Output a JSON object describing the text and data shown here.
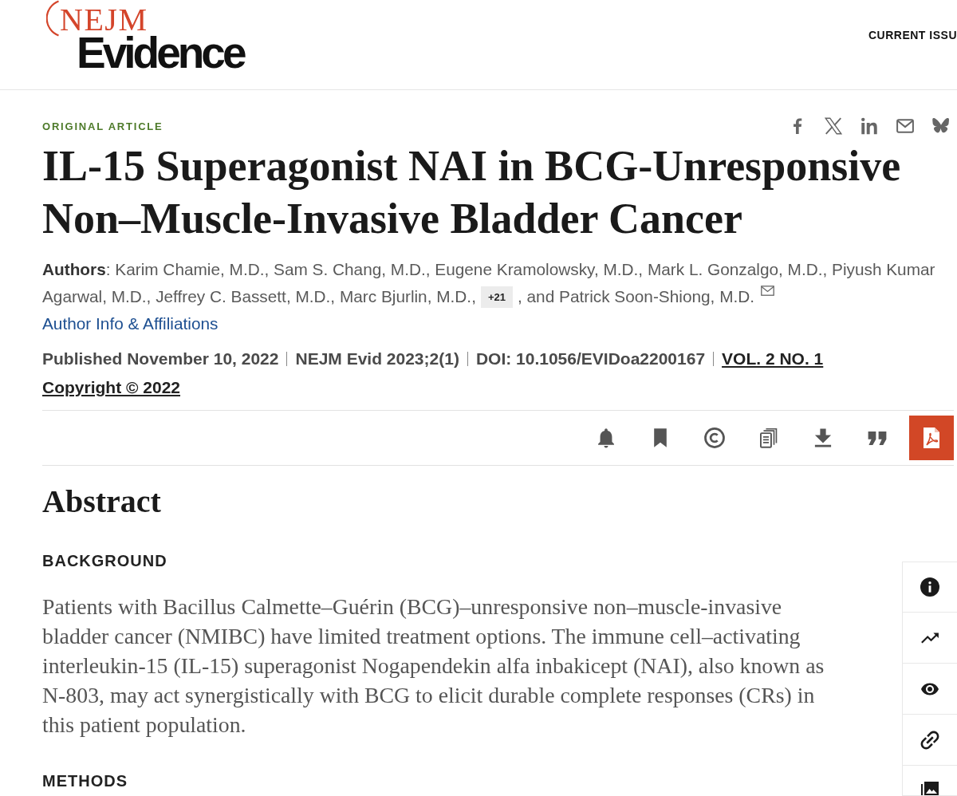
{
  "header": {
    "logo": {
      "wordmark": "NEJM",
      "title": "Evidence"
    },
    "nav": [
      "CURRENT ISSU"
    ]
  },
  "article": {
    "category": "ORIGINAL ARTICLE",
    "title": "IL-15 Superagonist NAI in BCG-Unresponsive Non–Muscle-Invasive Bladder Cancer",
    "authors": {
      "list": "**Authors**: Karim Chamie, M.D., Sam S. Chang, M.D., Eugene Kramolowsky, M.D., Mark L. Gonzalgo, M.D., Piyush Kumar Agarwal, M.D., Jeffrey C. Bassett, M.D., Marc Bjurlin, M.D.,",
      "more_button": "+21",
      "last": ", and Patrick Soon-Shiong, M.D.",
      "info_link": "Author Info & Affiliations"
    },
    "meta": [
      {
        "kind": "text",
        "text": "Published November 10, 2022"
      },
      {
        "kind": "text",
        "text": "NEJM Evid 2023;2(1)"
      },
      {
        "kind": "text",
        "text": "DOI: 10.1056/EVIDoa2200167"
      },
      {
        "kind": "link",
        "text": "VOL. 2 NO. 1"
      }
    ],
    "copyright": "Copyright © 2022"
  },
  "abstract": {
    "heading": "Abstract",
    "sections": [
      {
        "heading": "BACKGROUND",
        "text": "Patients with Bacillus Calmette–Guérin (BCG)–unresponsive non–muscle-invasive bladder cancer (NMIBC) have limited treatment options. The immune cell–activating interleukin-15 (IL-15) superagonist Nogapendekin alfa inbakicept (NAI), also known as N-803, may act synergistically with BCG to elicit durable complete responses (CRs) in this patient population."
      },
      {
        "heading": "METHODS"
      }
    ]
  }
}
